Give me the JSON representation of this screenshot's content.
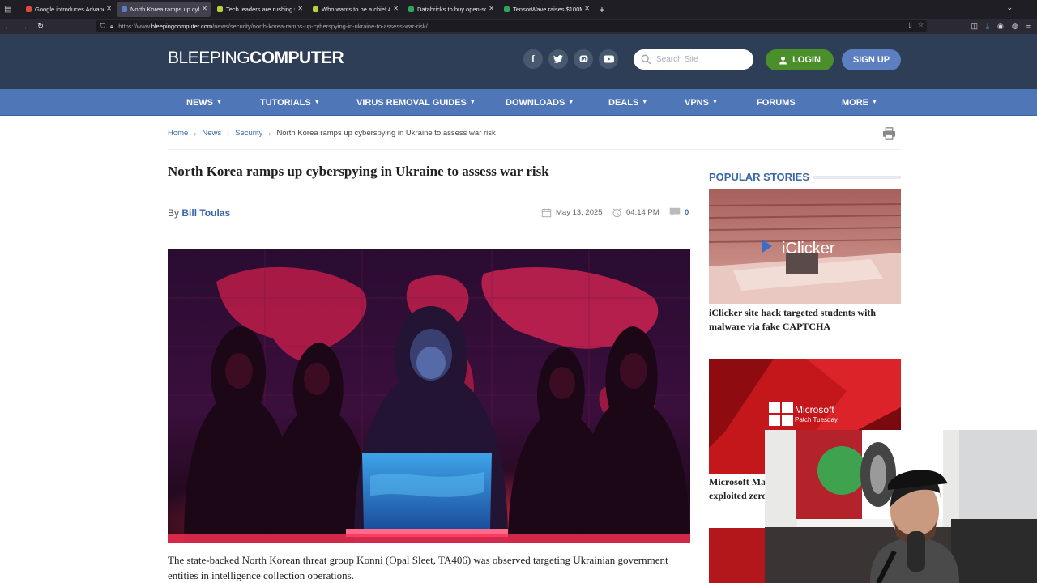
{
  "browser": {
    "tabs": [
      {
        "label": "Google introduces Advanc",
        "favicon_color": "#e04a3b"
      },
      {
        "label": "North Korea ramps up cyb",
        "favicon_color": "#5a7fc4"
      },
      {
        "label": "Tech leaders are rushing to",
        "favicon_color": "#b6d43a"
      },
      {
        "label": "Who wants to be a chief AI",
        "favicon_color": "#b6d43a"
      },
      {
        "label": "Databricks to buy open-so",
        "favicon_color": "#2fa55a"
      },
      {
        "label": "TensorWave raises $100M",
        "favicon_color": "#2fa55a"
      }
    ],
    "active_tab": 1,
    "url_prefix": "https://www.",
    "url_domain": "bleepingcomputer.com",
    "url_path": "/news/security/north-korea-ramps-up-cyberspying-in-ukraine-to-assess-war-risk/"
  },
  "header": {
    "logo_part1": "BLEEPING",
    "logo_part2": "COMPUTER",
    "social_icons": [
      "facebook-icon",
      "twitter-icon",
      "mastodon-icon",
      "youtube-icon"
    ],
    "search_placeholder": "Search Site",
    "login_label": "LOGIN",
    "signup_label": "SIGN UP",
    "colors": {
      "header_bg": "#2e3e57",
      "nav_bg": "#4f77b8",
      "login": "#4a8f2a",
      "signup": "#5b7fc0",
      "link": "#3a67a8"
    }
  },
  "nav": [
    {
      "label": "NEWS",
      "dropdown": true
    },
    {
      "label": "TUTORIALS",
      "dropdown": true
    },
    {
      "label": "VIRUS REMOVAL GUIDES",
      "dropdown": true
    },
    {
      "label": "DOWNLOADS",
      "dropdown": true
    },
    {
      "label": "DEALS",
      "dropdown": true
    },
    {
      "label": "VPNS",
      "dropdown": true
    },
    {
      "label": "FORUMS",
      "dropdown": false
    },
    {
      "label": "MORE",
      "dropdown": true
    }
  ],
  "breadcrumb": {
    "home": "Home",
    "news": "News",
    "security": "Security",
    "current": "North Korea ramps up cyberspying in Ukraine to assess war risk"
  },
  "article": {
    "title": "North Korea ramps up cyberspying in Ukraine to assess war risk",
    "by": "By",
    "author": "Bill Toulas",
    "date": "May 13, 2025",
    "time": "04:14 PM",
    "comments": "0",
    "lead": "The state-backed North Korean threat group Konni (Opal Sleet, TA406) was observed targeting Ukrainian government entities in intelligence collection operations."
  },
  "sidebar": {
    "heading": "POPULAR STORIES",
    "story1": {
      "title": "iClicker site hack targeted students with malware via fake CAPTCHA",
      "image_text": "iClicker"
    },
    "story2": {
      "title": "Microsoft May 2025 Patch Tuesday fixes 5 exploited zero-days",
      "image_brand": "Microsoft",
      "image_sub": "Patch Tuesday"
    }
  }
}
